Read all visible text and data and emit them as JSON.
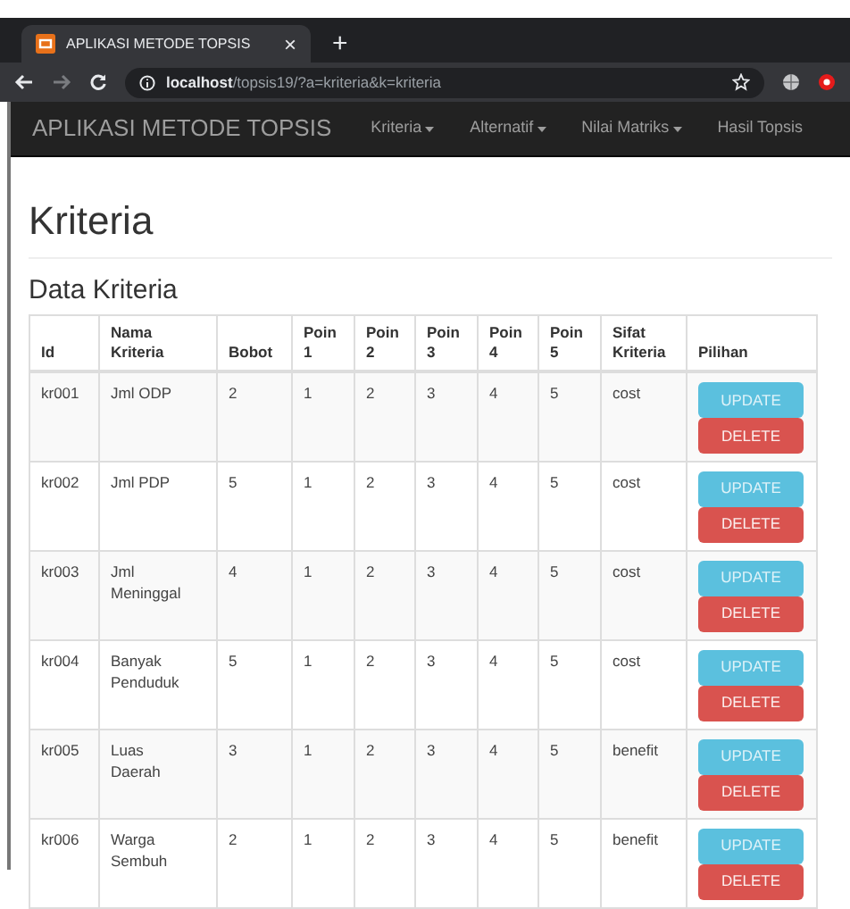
{
  "browser": {
    "tab_title": "APLIKASI METODE TOPSIS",
    "tab_close": "×",
    "new_tab": "+",
    "url_host": "localhost",
    "url_path": "/topsis19/?a=kriteria&k=kriteria"
  },
  "navbar": {
    "brand": "APLIKASI METODE TOPSIS",
    "items": [
      {
        "label": "Kriteria",
        "dropdown": true
      },
      {
        "label": "Alternatif",
        "dropdown": true
      },
      {
        "label": "Nilai Matriks",
        "dropdown": true
      },
      {
        "label": "Hasil Topsis",
        "dropdown": false
      }
    ]
  },
  "page_title": "Kriteria",
  "section_title": "Data Kriteria",
  "table": {
    "columns": [
      "Id",
      "Nama Kriteria",
      "Bobot",
      "Poin 1",
      "Poin 2",
      "Poin 3",
      "Poin 4",
      "Poin 5",
      "Sifat Kriteria",
      "Pilihan"
    ],
    "rows": [
      {
        "cells": [
          "kr001",
          "Jml ODP",
          "2",
          "1",
          "2",
          "3",
          "4",
          "5",
          "cost"
        ],
        "actions": [
          "UPDATE",
          "DELETE"
        ]
      },
      {
        "cells": [
          "kr002",
          "Jml PDP",
          "5",
          "1",
          "2",
          "3",
          "4",
          "5",
          "cost"
        ],
        "actions": [
          "UPDATE",
          "DELETE"
        ]
      },
      {
        "cells": [
          "kr003",
          "Jml Meninggal",
          "4",
          "1",
          "2",
          "3",
          "4",
          "5",
          "cost"
        ],
        "actions": [
          "UPDATE",
          "DELETE"
        ]
      },
      {
        "cells": [
          "kr004",
          "Banyak Penduduk",
          "5",
          "1",
          "2",
          "3",
          "4",
          "5",
          "cost"
        ],
        "actions": [
          "UPDATE",
          "DELETE"
        ]
      },
      {
        "cells": [
          "kr005",
          "Luas Daerah",
          "3",
          "1",
          "2",
          "3",
          "4",
          "5",
          "benefit"
        ],
        "actions": [
          "UPDATE",
          "DELETE"
        ]
      },
      {
        "cells": [
          "kr006",
          "Warga Sembuh",
          "2",
          "1",
          "2",
          "3",
          "4",
          "5",
          "benefit"
        ],
        "actions": [
          "UPDATE",
          "DELETE"
        ]
      }
    ]
  }
}
